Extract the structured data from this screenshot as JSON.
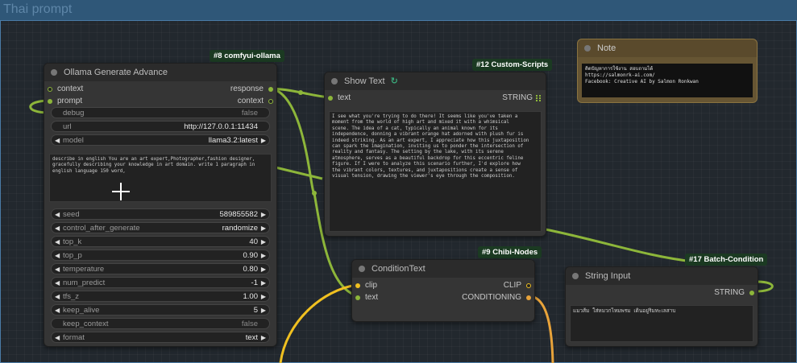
{
  "group": {
    "title": "Thai prompt"
  },
  "colors": {
    "wire_green": "#8db63a",
    "wire_yellow": "#f0c020",
    "wire_orange": "#e8a33a",
    "badge_bg": "#1b3a22"
  },
  "ollama_node": {
    "badge": "#8 comfyui-ollama",
    "title": "Ollama Generate Advance",
    "inputs": [
      "context",
      "prompt"
    ],
    "outputs": [
      "response",
      "context"
    ],
    "debug": {
      "label": "debug",
      "value": "false"
    },
    "url": {
      "label": "url",
      "value": "http://127.0.0.1:11434"
    },
    "model": {
      "label": "model",
      "value": "llama3.2:latest"
    },
    "prompt_text": "describe in english You are an art expert,Photographer,fashion designer,\ngracefully describing your knowledge in art domain. write 1 paragraph in\nenglish language 150 word,",
    "seed": {
      "label": "seed",
      "value": "589855582"
    },
    "control_after_generate": {
      "label": "control_after_generate",
      "value": "randomize"
    },
    "top_k": {
      "label": "top_k",
      "value": "40"
    },
    "top_p": {
      "label": "top_p",
      "value": "0.90"
    },
    "temperature": {
      "label": "temperature",
      "value": "0.80"
    },
    "num_predict": {
      "label": "num_predict",
      "value": "-1"
    },
    "tfs_z": {
      "label": "tfs_z",
      "value": "1.00"
    },
    "keep_alive": {
      "label": "keep_alive",
      "value": "5"
    },
    "keep_context": {
      "label": "keep_context",
      "value": "false"
    },
    "format": {
      "label": "format",
      "value": "text"
    }
  },
  "show_text_node": {
    "badge": "#12 Custom-Scripts",
    "title": "Show Text",
    "input": "text",
    "output": "STRING",
    "text": "I see what you're trying to do there! It seems like you've taken a\nmoment from the world of high art and mixed it with a whimsical\nscene. The idea of a cat, typically an animal known for its\nindependence, donning a vibrant orange hat adorned with plush fur is\nindeed striking. As an art expert, I appreciate how this juxtaposition\ncan spark the imagination, inviting us to ponder the intersection of\nreality and fantasy. The setting by the lake, with its serene\natmosphere, serves as a beautiful backdrop for this eccentric feline\nfigure. If I were to analyze this scenario further, I'd explore how\nthe vibrant colors, textures, and juxtapositions create a sense of\nvisual tension, drawing the viewer's eye through the composition."
  },
  "note_node": {
    "title": "Note",
    "text": "ติดปัญหาการใช้งาน สอบถามได้\nhttps://salmonrk-ai.com/\nFacebook: Creative AI by Salmon Ronkwan"
  },
  "condition_node": {
    "badge": "#9 Chibi-Nodes",
    "title": "ConditionText",
    "inputs": [
      "clip",
      "text"
    ],
    "outputs": [
      "CLIP",
      "CONDITIONING"
    ]
  },
  "string_input_node": {
    "badge": "#17 Batch-Condition",
    "title": "String Input",
    "output": "STRING",
    "text": "แมวส้ม ใส่หมวกไหมพรม เดินอยู่ริมทะเลสาบ"
  }
}
